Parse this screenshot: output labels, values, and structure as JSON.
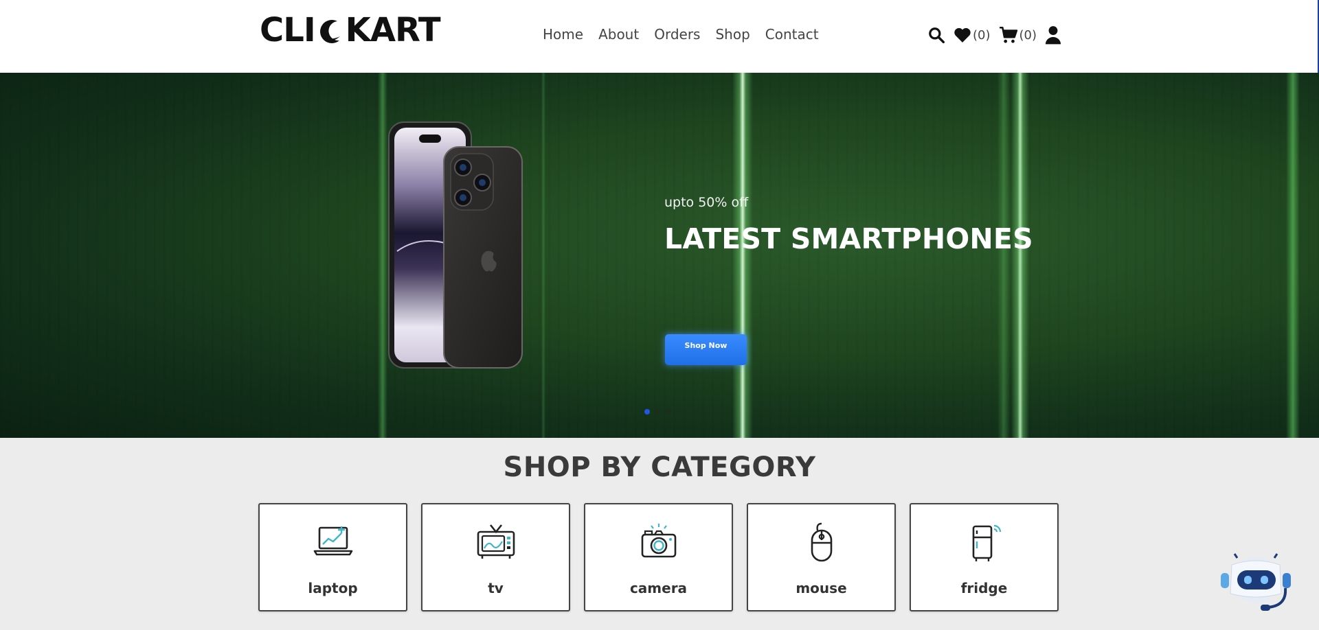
{
  "brand": {
    "name_left": "CLI",
    "name_right": "KART"
  },
  "nav": {
    "items": [
      {
        "label": "Home"
      },
      {
        "label": "About"
      },
      {
        "label": "Orders"
      },
      {
        "label": "Shop"
      },
      {
        "label": "Contact"
      }
    ]
  },
  "header_icons": {
    "search": "search-icon",
    "wishlist": {
      "icon": "heart-icon",
      "count": "(0)"
    },
    "cart": {
      "icon": "cart-icon",
      "count": "(0)"
    },
    "account": "user-icon"
  },
  "hero": {
    "promo": "upto 50% off",
    "title": "LATEST SMARTPHONES",
    "button": "Shop Now",
    "slides": 3,
    "active_slide": 1
  },
  "categories": {
    "title": "SHOP BY CATEGORY",
    "items": [
      {
        "label": "laptop",
        "icon": "laptop-icon"
      },
      {
        "label": "tv",
        "icon": "tv-icon"
      },
      {
        "label": "camera",
        "icon": "camera-icon"
      },
      {
        "label": "mouse",
        "icon": "mouse-icon"
      },
      {
        "label": "fridge",
        "icon": "fridge-icon"
      }
    ]
  },
  "colors": {
    "accent": "#2457e0",
    "button": "#1f6fe8",
    "hero_bg": "#1f461f",
    "icon_teal": "#3fb5c8"
  }
}
